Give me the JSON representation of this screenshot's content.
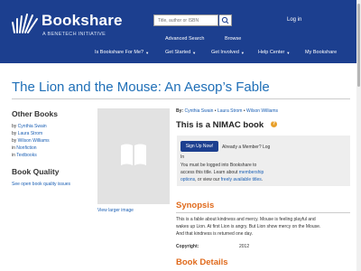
{
  "header": {
    "logo_title": "Bookshare",
    "logo_subtitle": "A BENETECH INITIATIVE",
    "search_placeholder": "Title, author or ISBN",
    "login": "Log in",
    "advanced_search": "Advanced Search",
    "browse": "Browse",
    "nav": [
      "Is Bookshare For Me?",
      "Get Started",
      "Get Involved",
      "Help Center",
      "My Bookshare"
    ],
    "colors": {
      "bar": "#1c3f8f",
      "title": "#1f6fb7",
      "section": "#e06a1c"
    }
  },
  "book": {
    "title": "The Lion and the Mouse: An Aesop’s Fable"
  },
  "sidebar": {
    "other_books_heading": "Other Books",
    "items": [
      {
        "prefix": "by ",
        "link": "Cynthia Swain"
      },
      {
        "prefix": "by ",
        "link": "Laura Strom"
      },
      {
        "prefix": "by ",
        "link": "Wilson Williams"
      },
      {
        "prefix": "in ",
        "link": "Nonfiction"
      },
      {
        "prefix": "in ",
        "link": "Textbooks"
      }
    ],
    "quality_heading": "Book Quality",
    "quality_link": "See open book quality issues"
  },
  "cover": {
    "icon": "book-icon",
    "larger_link": "View larger image"
  },
  "details": {
    "by_label": "By:",
    "authors": [
      "Cynthia Swain",
      "Laura Strom",
      "Wilson Williams"
    ],
    "author_sep": " • ",
    "nimac_heading": "This is a NIMAC book",
    "help_icon": "?",
    "signup_button": "Sign Up Now!",
    "already_member": "Already a Member?",
    "log_in": "Log",
    "log_in_wrap": "In",
    "notice_line1": "You must be logged into Bookshare to",
    "notice_line2_a": "access this title. Learn about ",
    "notice_line2_link": "membership",
    "notice_line3_link1": "options",
    "notice_line3_mid": ", or view our ",
    "notice_line3_link2": "freely available titles",
    "notice_line3_end": ".",
    "synopsis_heading": "Synopsis",
    "synopsis_line1": "This is a fable about kindness and mercy. Mouse is feeling playful and",
    "synopsis_line2": "wakes up Lion. At first Lion is angry. But Lion show mercy on the Mouse.",
    "synopsis_line3": "And that kindness is returned one day.",
    "copyright_label": "Copyright:",
    "copyright_value": "2012",
    "book_details_heading": "Book Details"
  }
}
